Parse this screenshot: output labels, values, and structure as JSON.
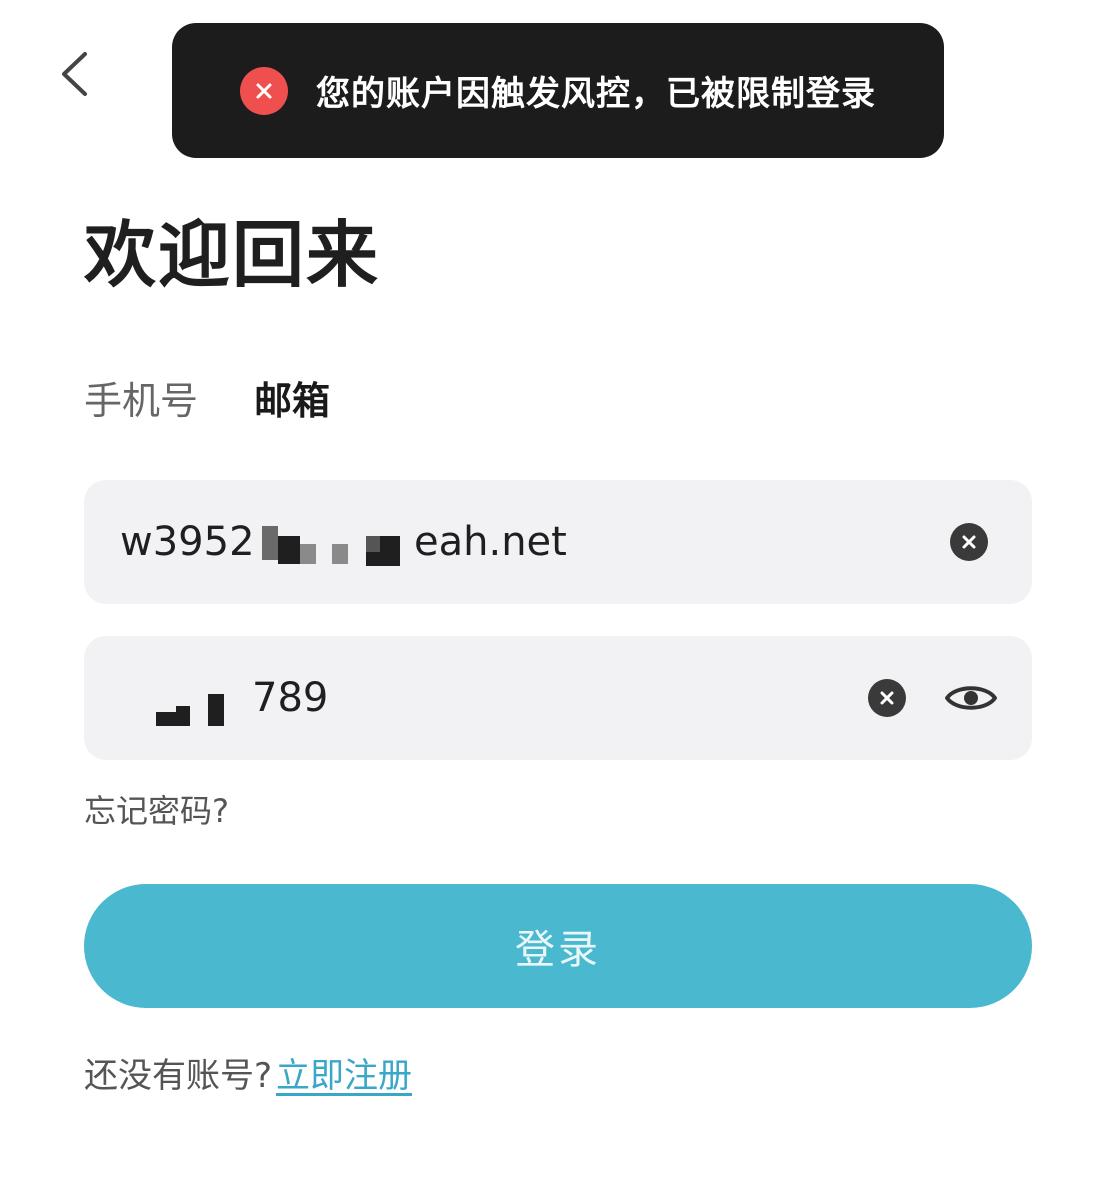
{
  "toast": {
    "icon": "error-x-icon",
    "message": "您的账户因触发风控，已被限制登录",
    "icon_color": "#ef4f4f"
  },
  "header": {
    "back_icon": "chevron-left-icon"
  },
  "title": "欢迎回来",
  "tabs": [
    {
      "label": "手机号",
      "active": false
    },
    {
      "label": "邮箱",
      "active": true
    }
  ],
  "email_field": {
    "value_prefix": "w3952",
    "value_suffix": "eah.net",
    "clear_icon": "clear-x-icon"
  },
  "password_field": {
    "value_suffix": "789",
    "clear_icon": "clear-x-icon",
    "toggle_icon": "eye-icon"
  },
  "forgot_password": "忘记密码?",
  "login_button": "登录",
  "signup": {
    "prompt": "还没有账号?",
    "link": "立即注册"
  },
  "colors": {
    "accent": "#4ab8cf",
    "link": "#3aa7c8",
    "toast_bg": "#1c1c1c",
    "field_bg": "#f2f2f4"
  }
}
